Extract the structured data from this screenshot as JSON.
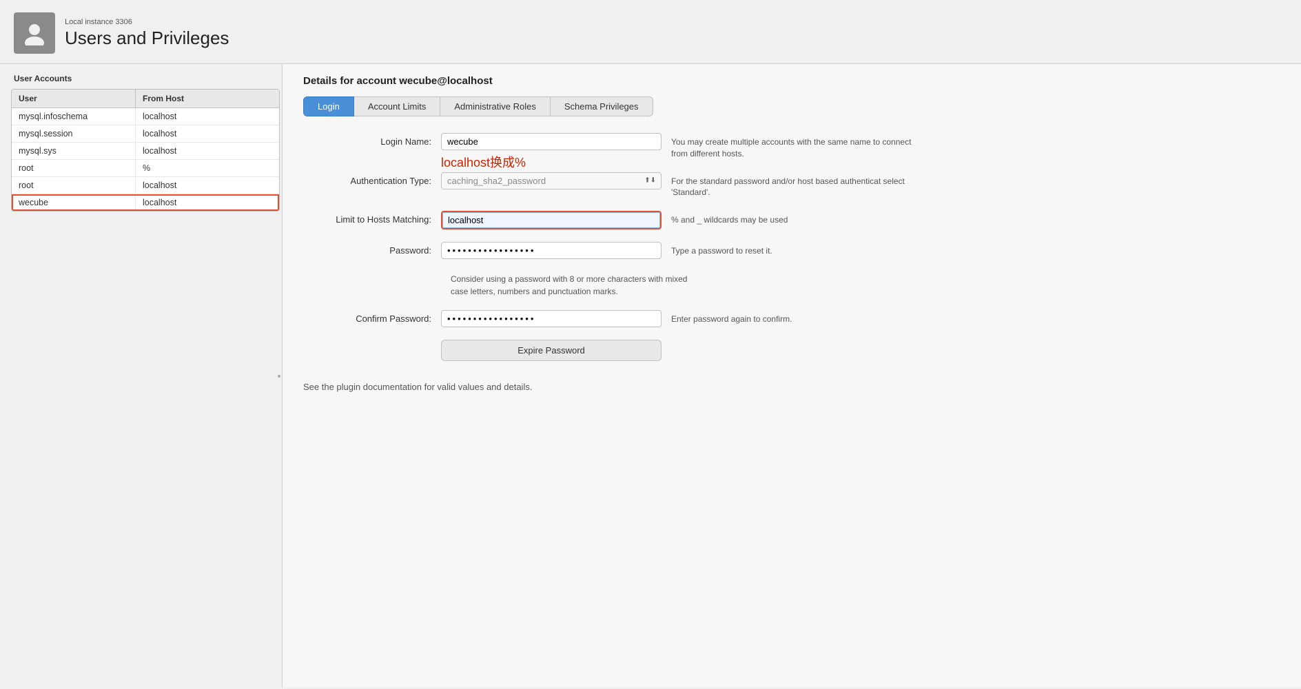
{
  "header": {
    "subtitle": "Local instance 3306",
    "title": "Users and Privileges"
  },
  "sidebar": {
    "section_title": "User Accounts",
    "columns": {
      "user": "User",
      "from_host": "From Host"
    },
    "users": [
      {
        "user": "mysql.infoschema",
        "host": "localhost"
      },
      {
        "user": "mysql.session",
        "host": "localhost"
      },
      {
        "user": "mysql.sys",
        "host": "localhost"
      },
      {
        "user": "root",
        "host": "%"
      },
      {
        "user": "root",
        "host": "localhost"
      },
      {
        "user": "wecube",
        "host": "localhost"
      }
    ],
    "selected_index": 5
  },
  "content": {
    "heading": "Details for account wecube@localhost",
    "tabs": [
      {
        "id": "login",
        "label": "Login",
        "active": true
      },
      {
        "id": "account-limits",
        "label": "Account Limits",
        "active": false
      },
      {
        "id": "admin-roles",
        "label": "Administrative Roles",
        "active": false
      },
      {
        "id": "schema-privileges",
        "label": "Schema Privileges",
        "active": false
      }
    ],
    "form": {
      "login_name_label": "Login Name:",
      "login_name_value": "wecube",
      "login_name_hint": "You may create multiple accounts with the same name to connect from different hosts.",
      "annotation_text": "localhost换成%",
      "auth_type_label": "Authentication Type:",
      "auth_type_placeholder": "caching_sha2_password",
      "auth_type_hint": "For the standard password and/or host based authenticat select 'Standard'.",
      "hosts_label": "Limit to Hosts Matching:",
      "hosts_value": "localhost",
      "hosts_hint": "% and _ wildcards may be used",
      "password_label": "Password:",
      "password_value": "••••••••••••••••",
      "password_hint": "Type a password to reset it.",
      "password_hint2": "Consider using a password with 8 or more characters with mixed case letters, numbers and punctuation marks.",
      "confirm_label": "Confirm Password:",
      "confirm_value": "••••••••••••••••",
      "confirm_hint": "Enter password again to confirm.",
      "expire_btn_label": "Expire Password",
      "footer_note": "See the plugin documentation for valid values and details."
    }
  }
}
